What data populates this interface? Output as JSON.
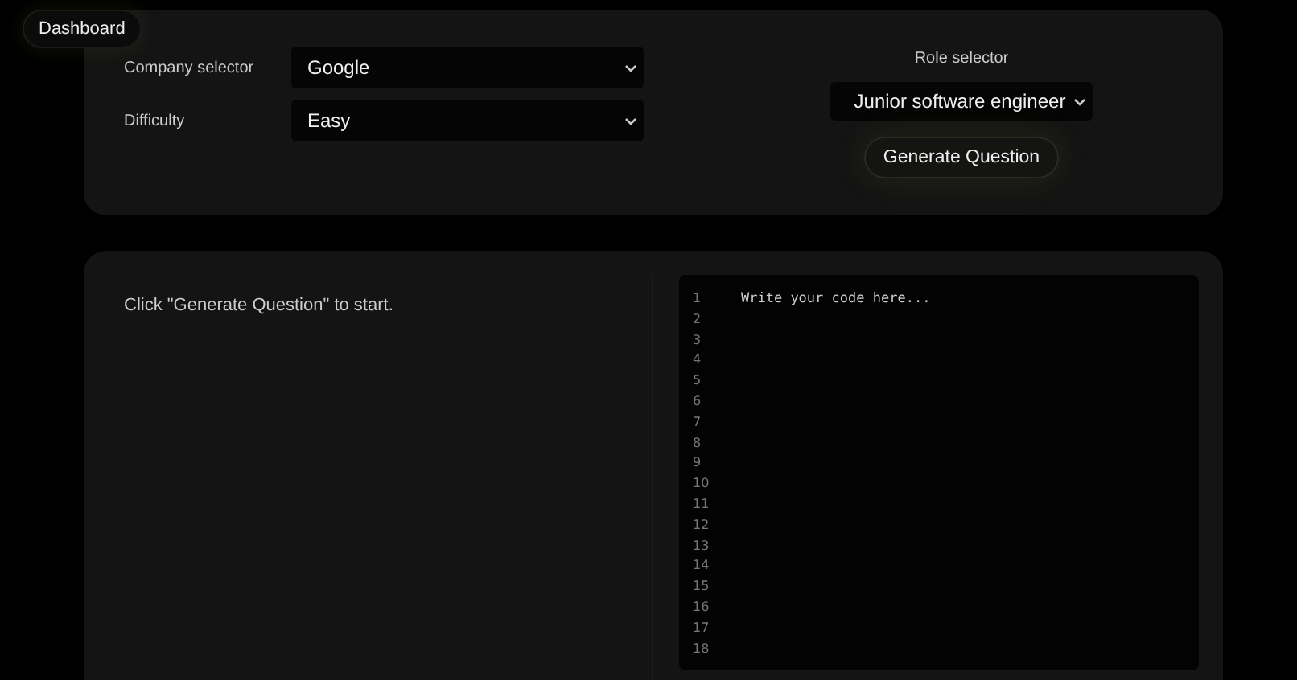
{
  "nav": {
    "label": "Dashboard"
  },
  "filters": [
    {
      "label": "Company selector",
      "value": "Google"
    },
    {
      "label": "Difficulty",
      "value": "Easy"
    }
  ],
  "role": {
    "label": "Role selector",
    "value": "Junior software engineer"
  },
  "generate_button": "Generate Question",
  "question": {
    "prompt": "Click \"Generate Question\" to start."
  },
  "editor": {
    "placeholder": "Write your code here...",
    "line_numbers": [
      "1",
      "2",
      "3",
      "4",
      "5",
      "6",
      "7",
      "8",
      "9",
      "10",
      "11",
      "12",
      "13",
      "14",
      "15",
      "16",
      "17",
      "18"
    ]
  }
}
